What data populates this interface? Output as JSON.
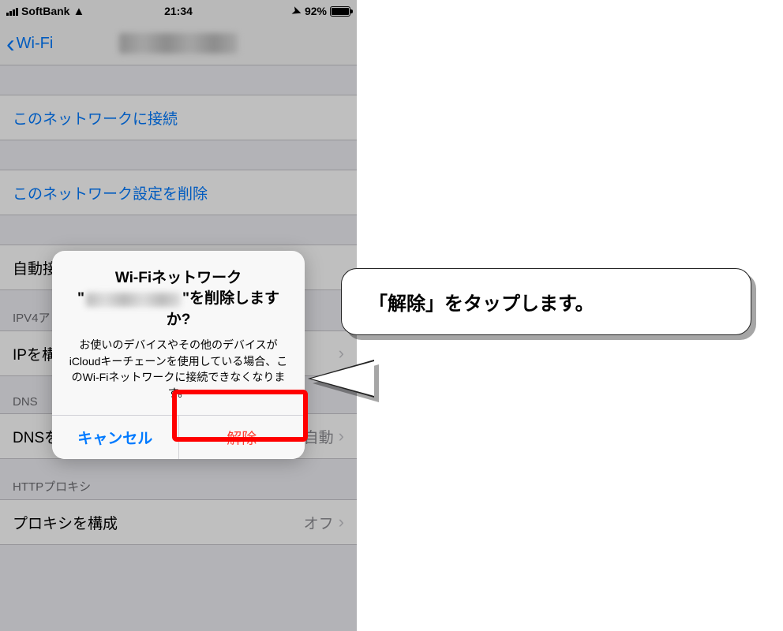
{
  "statusbar": {
    "carrier": "SoftBank",
    "time": "21:34",
    "battery": "92%"
  },
  "nav": {
    "back": "Wi-Fi"
  },
  "cells": {
    "join": "このネットワークに接続",
    "forget": "このネットワーク設定を削除",
    "auto_join_label": "自動接",
    "ipv4_header": "IPV4ア",
    "ip_config_label": "IPを構",
    "dns_header": "DNS",
    "dns_config_label": "DNSを構成",
    "dns_config_value": "自動",
    "proxy_header": "HTTPプロキシ",
    "proxy_config_label": "プロキシを構成",
    "proxy_config_value": "オフ"
  },
  "alert": {
    "title_line1": "Wi-Fiネットワーク",
    "title_line2_prefix": "\"",
    "title_line2_suffix": "\"を削除しますか?",
    "message": "お使いのデバイスやその他のデバイスがiCloudキーチェーンを使用している場合、このWi-Fiネットワークに接続できなくなります。",
    "cancel": "キャンセル",
    "confirm": "解除"
  },
  "callout": {
    "text": "「解除」をタップします。"
  }
}
